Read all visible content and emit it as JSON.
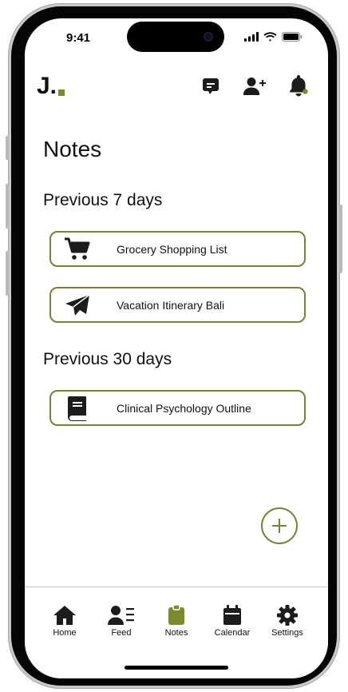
{
  "status": {
    "time": "9:41"
  },
  "header": {
    "logo_text": "J.",
    "icons": [
      "message-icon",
      "add-user-icon",
      "bell-icon"
    ]
  },
  "page": {
    "title": "Notes"
  },
  "sections": [
    {
      "label": "Previous 7 days",
      "notes": [
        {
          "title": "Grocery Shopping List",
          "icon": "cart-icon"
        },
        {
          "title": "Vacation Itinerary Bali",
          "icon": "paper-plane-icon"
        }
      ]
    },
    {
      "label": "Previous 30 days",
      "notes": [
        {
          "title": "Clinical Psychology Outline",
          "icon": "book-icon"
        }
      ]
    }
  ],
  "tabs": [
    {
      "label": "Home",
      "icon": "home-icon"
    },
    {
      "label": "Feed",
      "icon": "feed-icon"
    },
    {
      "label": "Notes",
      "icon": "clipboard-icon",
      "active": true
    },
    {
      "label": "Calendar",
      "icon": "calendar-icon"
    },
    {
      "label": "Settings",
      "icon": "gear-icon"
    }
  ],
  "colors": {
    "accent": "#7a8036",
    "logo_accent": "#7c8a2e",
    "notification_dot": "#7c8a2e",
    "text": "#111111"
  }
}
